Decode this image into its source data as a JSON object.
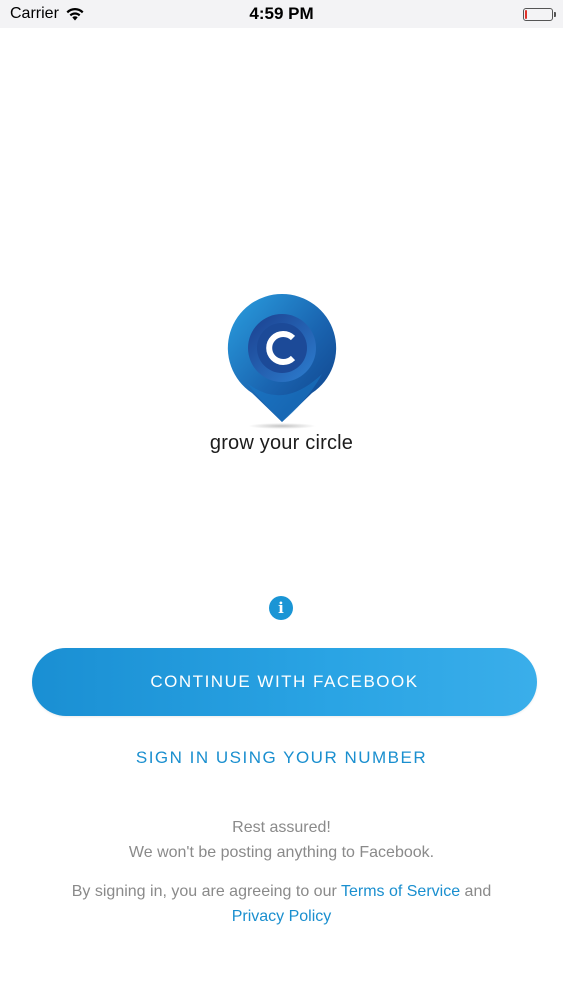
{
  "status_bar": {
    "carrier": "Carrier",
    "time": "4:59 PM",
    "battery_level": 0.05,
    "icons": [
      "wifi-icon",
      "battery-icon"
    ]
  },
  "branding": {
    "logo_letter": "C",
    "tagline": "grow your circle"
  },
  "actions": {
    "info_label": "i",
    "facebook_label": "CONTINUE WITH FACEBOOK",
    "number_label": "SIGN IN USING YOUR NUMBER"
  },
  "reassurance": {
    "line1": "Rest assured!",
    "line2": "We won't be posting anything to Facebook."
  },
  "legal": {
    "prefix": "By signing in, you are agreeing to our ",
    "terms_link": "Terms of Service",
    "joiner": " and",
    "privacy_link": "Privacy Policy"
  },
  "colors": {
    "accent": "#1a8fcf",
    "button_start": "#1a8fd3",
    "button_end": "#3aaeea",
    "muted_text": "#8a8a8a",
    "battery_low": "#e0332b"
  }
}
